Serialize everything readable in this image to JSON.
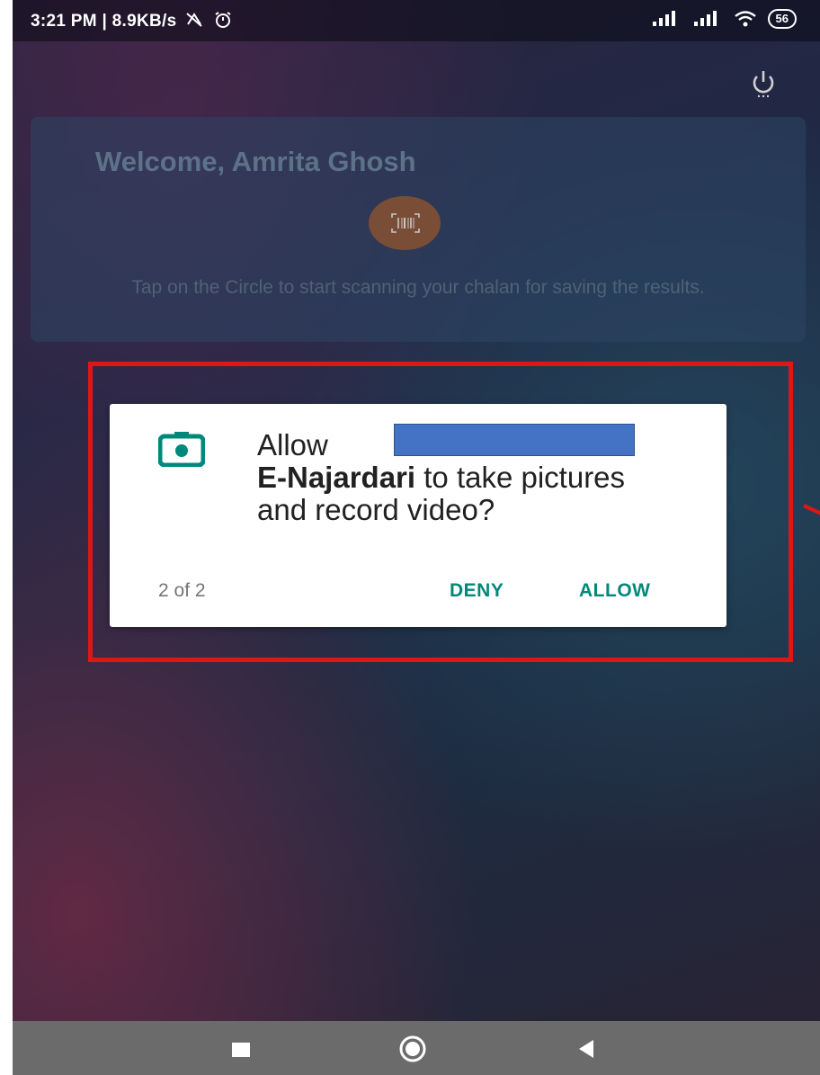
{
  "status_bar": {
    "time_and_speed": "3:21 PM | 8.9KB/s",
    "icons": [
      "sync-off-icon",
      "alarm-icon",
      "signal-icon",
      "signal-icon",
      "wifi-icon"
    ],
    "battery": "56"
  },
  "header": {
    "power_icon": "power-icon"
  },
  "welcome": {
    "title": "Welcome, Amrita Ghosh",
    "scan_icon": "barcode-icon",
    "hint": "Tap on the Circle to start scanning your chalan for saving the results."
  },
  "dialog": {
    "icon": "camera-icon",
    "prefix": "Allow",
    "app_name": "E-Najardari",
    "message": "to take pictures and record video?",
    "counter": "2 of 2",
    "deny_label": "DENY",
    "allow_label": "ALLOW",
    "accent_color": "#00897b"
  },
  "annotation": {
    "highlight_color": "#e01616",
    "redaction_color": "#4472c4"
  },
  "nav_bar": {
    "buttons": [
      "recents-icon",
      "home-icon",
      "back-icon"
    ]
  }
}
